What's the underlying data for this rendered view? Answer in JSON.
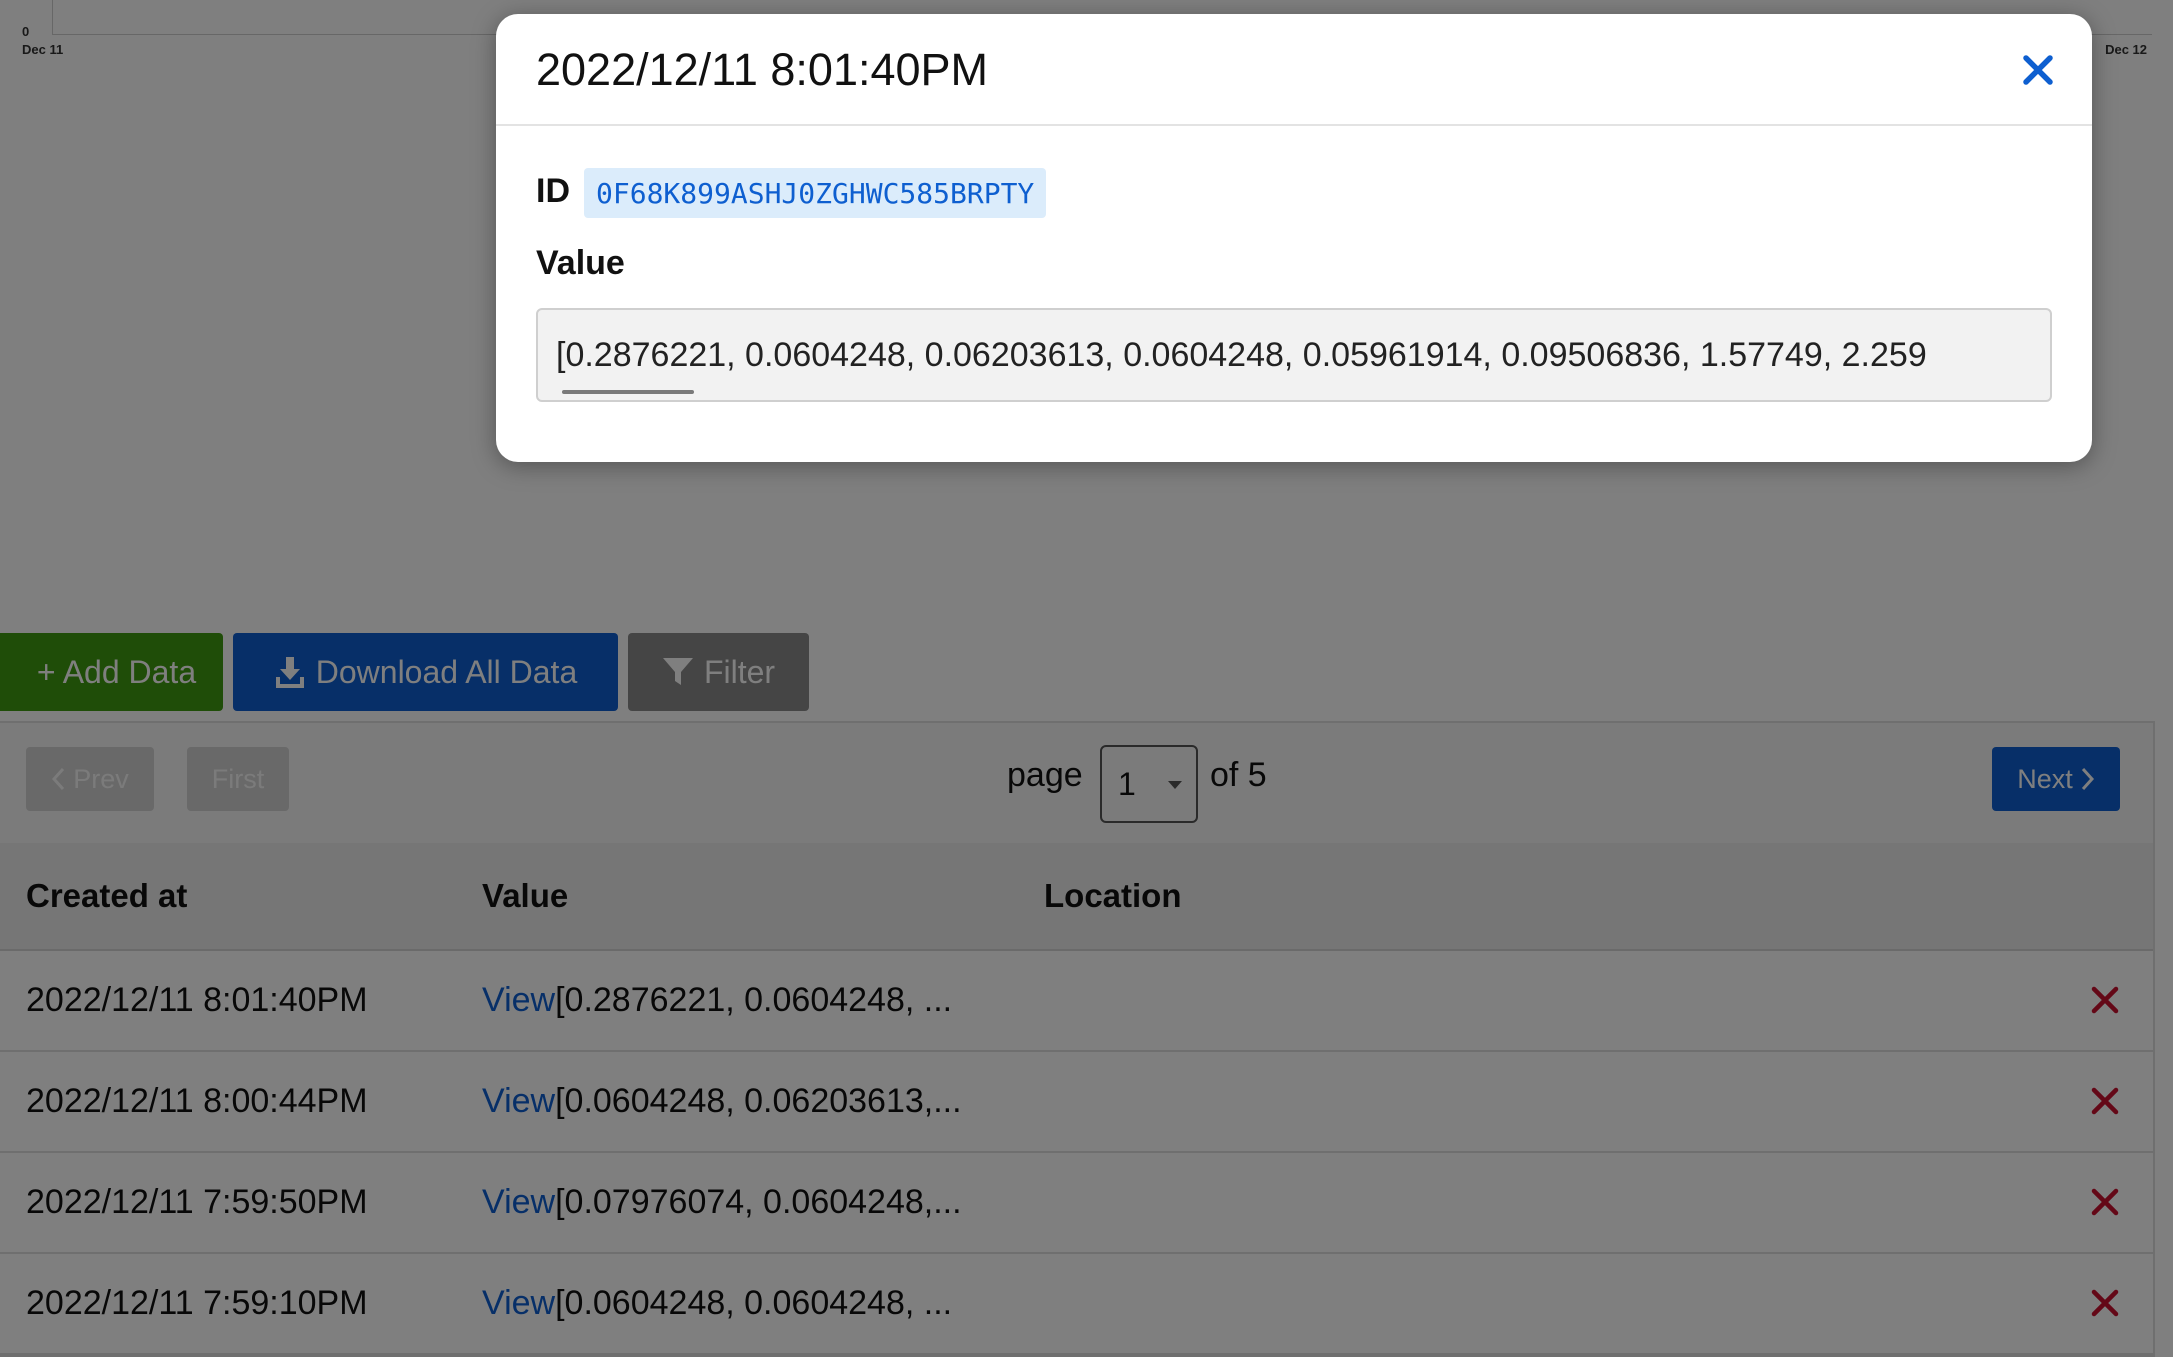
{
  "chart": {
    "y_tick": "0",
    "x_tick_left": "Dec 11",
    "x_tick_right": "Dec 12"
  },
  "toolbar": {
    "add_label": "+ Add Data",
    "download_label": "Download All Data",
    "filter_label": "Filter"
  },
  "pager": {
    "prev_label": "Prev",
    "first_label": "First",
    "page_word": "page",
    "current_page": "1",
    "of_label": "of 5",
    "next_label": "Next"
  },
  "table": {
    "headers": [
      "Created at",
      "Value",
      "Location"
    ],
    "rows": [
      {
        "created": "2022/12/11 8:01:40PM",
        "link": "View",
        "value": "[0.2876221, 0.0604248, ..."
      },
      {
        "created": "2022/12/11 8:00:44PM",
        "link": "View",
        "value": "[0.0604248, 0.06203613,..."
      },
      {
        "created": "2022/12/11 7:59:50PM",
        "link": "View",
        "value": "[0.07976074, 0.0604248,..."
      },
      {
        "created": "2022/12/11 7:59:10PM",
        "link": "View",
        "value": "[0.0604248, 0.0604248, ..."
      }
    ]
  },
  "modal": {
    "title": "2022/12/11 8:01:40PM",
    "id_label": "ID",
    "id_value": "0F68K899ASHJ0ZGHWC585BRPTY",
    "value_label": "Value",
    "value_text": "[0.2876221, 0.0604248, 0.06203613, 0.0604248, 0.05961914, 0.09506836, 1.57749, 2.259"
  },
  "colors": {
    "primary": "#0e5fd0",
    "add_green": "#3f9b10",
    "filter_gray": "#8a8a8a",
    "delete_red": "#c8102e",
    "overlay": "rgba(0,0,0,0.5)"
  }
}
